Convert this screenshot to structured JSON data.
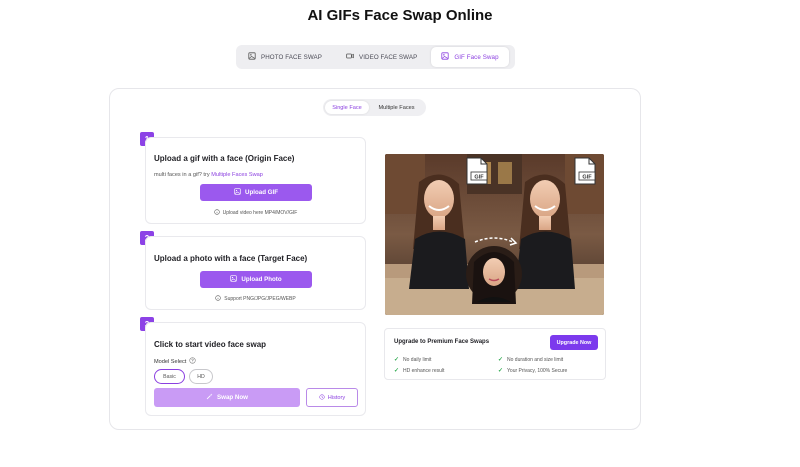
{
  "page": {
    "title": "AI GIFs Face Swap Online"
  },
  "tabs": [
    {
      "label": "PHOTO FACE SWAP",
      "icon": "image-icon"
    },
    {
      "label": "VIDEO FACE SWAP",
      "icon": "video-icon"
    },
    {
      "label": "GIF Face Swap",
      "icon": "gif-icon",
      "active": true
    }
  ],
  "subtabs": [
    {
      "label": "Single Face",
      "active": true
    },
    {
      "label": "Multiple Faces"
    }
  ],
  "steps": {
    "one": {
      "number": "1",
      "title": "Upload a gif with a face (Origin Face)",
      "hint_prefix": "multi faces in a gif? try",
      "hint_link": "Multiple Faces Swap",
      "button": "Upload GIF",
      "support": "Upload video here MP4/MOV/GIF"
    },
    "two": {
      "number": "2",
      "title": "Upload a photo with a face (Target Face)",
      "button": "Upload Photo",
      "support": "Support PNG/JPG/JPEG/WEBP"
    },
    "three": {
      "number": "3",
      "title": "Click to start video face swap",
      "model_label": "Model Select",
      "models": [
        "Basic",
        "HD"
      ],
      "selected_model": "Basic",
      "swap_button": "Swap Now",
      "history_button": "History"
    }
  },
  "preview": {
    "badge_left": "GIF",
    "badge_right": "GIF"
  },
  "premium": {
    "title": "Upgrade to Premium Face Swaps",
    "button": "Upgrade Now",
    "features": [
      "No daily limit",
      "No duration and size limit",
      "HD enhance result",
      "Your Privacy, 100% Secure"
    ]
  },
  "colors": {
    "accent": "#8c42e6",
    "accent_light": "#c99bf5",
    "upgrade": "#7c3aed",
    "check": "#2eaa4f"
  }
}
